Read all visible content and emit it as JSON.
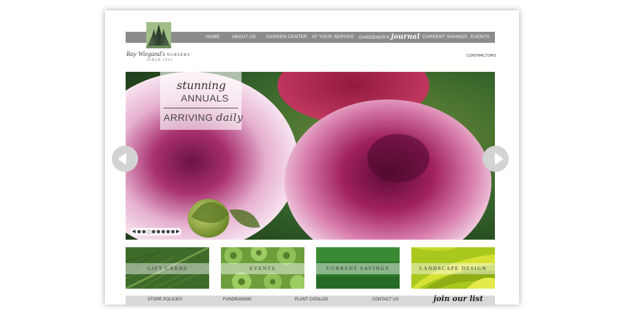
{
  "nav": {
    "items": [
      {
        "label": "HOME"
      },
      {
        "label": "ABOUT US"
      },
      {
        "label": "GARDEN CENTER"
      },
      {
        "label": "AT YOUR SERVICE"
      },
      {
        "label": "CURRENT SAVINGS"
      },
      {
        "label": "EVENTS"
      }
    ],
    "journal_prefix": "GARDENER'S",
    "journal_script": "journal"
  },
  "logo": {
    "name": "Ray Wiegand's",
    "name_caps": "NURSERY",
    "since": "SINCE 1941"
  },
  "contractors": "CONTRACTORS",
  "hero": {
    "line1": "stunning",
    "line2": "ANNUALS",
    "line3_plain": "ARRIVING",
    "line3_script": "daily",
    "active_slide": 3,
    "slide_count": 8
  },
  "tiles": [
    {
      "label": "GIFT CARDS"
    },
    {
      "label": "EVENTS"
    },
    {
      "label": "CURRENT SAVINGS"
    },
    {
      "label": "LANDSCAPE DESIGN"
    }
  ],
  "footer": {
    "links": [
      "STORE POLICIES",
      "FUNDRAISING",
      "PLANT CATALOG",
      "CONTACT US"
    ],
    "join": "join our list"
  },
  "icons": {
    "prev": "chevron-left-icon",
    "next": "chevron-right-icon",
    "logo": "pine-trees-icon"
  },
  "colors": {
    "nav_bar": "#8c8c8c",
    "logo_green": "#9fbf86",
    "footer_bar": "#d9d9d9"
  }
}
